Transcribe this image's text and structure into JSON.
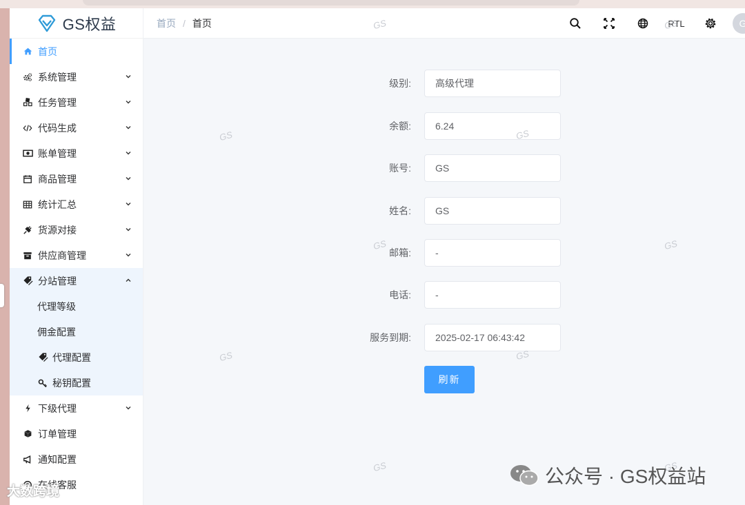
{
  "logo": {
    "text": "GS权益"
  },
  "sidebar": {
    "items": [
      {
        "label": "首页",
        "icon": "home-icon",
        "active": true
      },
      {
        "label": "系统管理",
        "icon": "gears-icon"
      },
      {
        "label": "任务管理",
        "icon": "cubes-icon"
      },
      {
        "label": "代码生成",
        "icon": "code-icon"
      },
      {
        "label": "账单管理",
        "icon": "money-icon"
      },
      {
        "label": "商品管理",
        "icon": "calendar-icon"
      },
      {
        "label": "统计汇总",
        "icon": "table-icon"
      },
      {
        "label": "货源对接",
        "icon": "plug-icon"
      },
      {
        "label": "供应商管理",
        "icon": "archive-icon"
      },
      {
        "label": "分站管理",
        "icon": "tags-icon",
        "open": true
      },
      {
        "label": "下级代理",
        "icon": "bolt-icon"
      },
      {
        "label": "订单管理",
        "icon": "cube-icon"
      },
      {
        "label": "通知配置",
        "icon": "bullhorn-icon"
      },
      {
        "label": "在线客服",
        "icon": "support-icon"
      }
    ],
    "subitems": [
      {
        "label": "代理等级"
      },
      {
        "label": "佣金配置"
      },
      {
        "label": "代理配置",
        "icon": "tags-icon"
      },
      {
        "label": "秘钥配置",
        "icon": "key-icon"
      }
    ]
  },
  "header": {
    "breadcrumb": [
      "首页",
      "首页"
    ],
    "rtl_label": "RTL",
    "avatar_letter": "G"
  },
  "form": {
    "fields": [
      {
        "label": "级别:",
        "value": "高级代理"
      },
      {
        "label": "余额:",
        "value": "6.24"
      },
      {
        "label": "账号:",
        "value": "GS"
      },
      {
        "label": "姓名:",
        "value": "GS"
      },
      {
        "label": "邮箱:",
        "value": "-"
      },
      {
        "label": "电话:",
        "value": "-"
      },
      {
        "label": "服务到期:",
        "value": "2025-02-17 06:43:42"
      }
    ],
    "refresh_label": "刷新"
  },
  "watermarks": {
    "gs": "GS",
    "wechat": "公众号 · GS权益站",
    "corner": "大数跨境"
  },
  "colors": {
    "accent": "#409eff",
    "menu_open_bg": "#eef5fd",
    "main_bg": "#f5f7fa"
  }
}
